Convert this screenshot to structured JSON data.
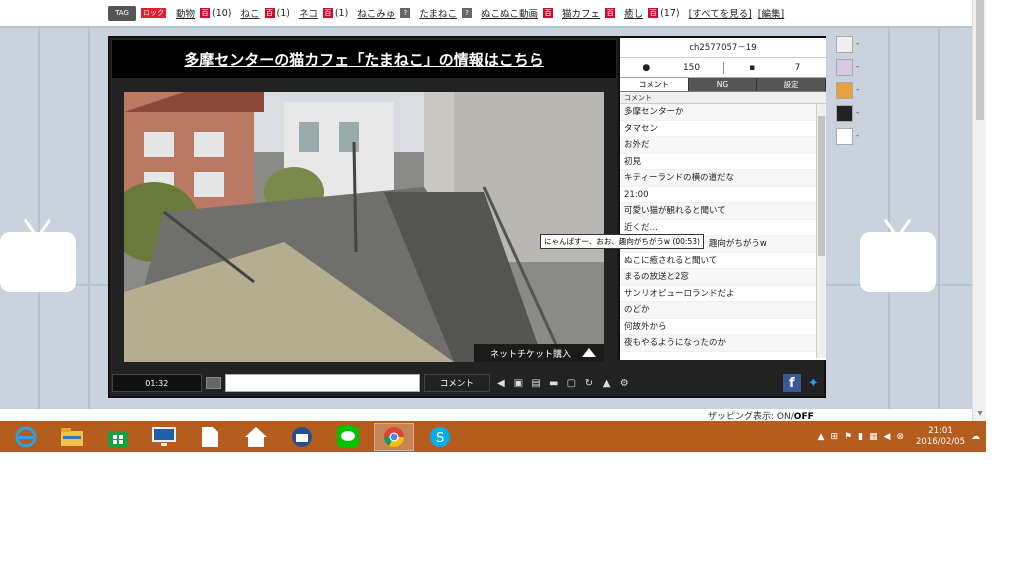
{
  "tagbar": {
    "badge": "TAG",
    "lock": "ロック",
    "tags": [
      {
        "label": "動物",
        "count": "(10)"
      },
      {
        "label": "ねこ",
        "count": "(1)"
      },
      {
        "label": "ネコ",
        "count": "(1)"
      },
      {
        "label": "ねこみゅ",
        "count": ""
      },
      {
        "label": "たまねこ",
        "count": ""
      },
      {
        "label": "ぬこぬこ動画",
        "count": ""
      },
      {
        "label": "猫カフェ",
        "count": ""
      },
      {
        "label": "癒し",
        "count": "(17)"
      }
    ],
    "show_all": "[すべてを見る]",
    "edit": "[編集]"
  },
  "player": {
    "title": "多摩センターの猫カフェ「たまねこ」の情報はこちら",
    "ticket": "ネットチケット購入",
    "time": "01:32",
    "comment_button": "コメント"
  },
  "side": {
    "channel_id": "ch2577057－19",
    "viewers": "150",
    "comments": "7",
    "tabs": [
      "コメント",
      "NG",
      "設定"
    ],
    "column": "コメント",
    "rows": [
      "多摩センターか",
      "タマセン",
      "お外だ",
      "初見",
      "キティーランドの横の道だな",
      "21:00",
      "可愛い猫が観れると聞いて",
      "近くだ…",
      "にゃんぱすー、おお、趣向がちがうw",
      "ぬこに癒されると聞いて",
      "まるの放送と2窓",
      "サンリオピューロランドだよ",
      "のどか",
      "何故外から",
      "夜もやるようになったのか"
    ]
  },
  "tooltip": "にゃんぱすー、おお、趣向がちがうw (00:53)",
  "zapping": {
    "label": "ザッピング表示:",
    "on": "ON",
    "sep": "/",
    "off": "OFF"
  },
  "clock": {
    "time": "21:01",
    "date": "2016/02/05"
  },
  "colors": {
    "taskbar": "#b55d1f",
    "stage": "#c8d3dd",
    "player": "#222222"
  }
}
